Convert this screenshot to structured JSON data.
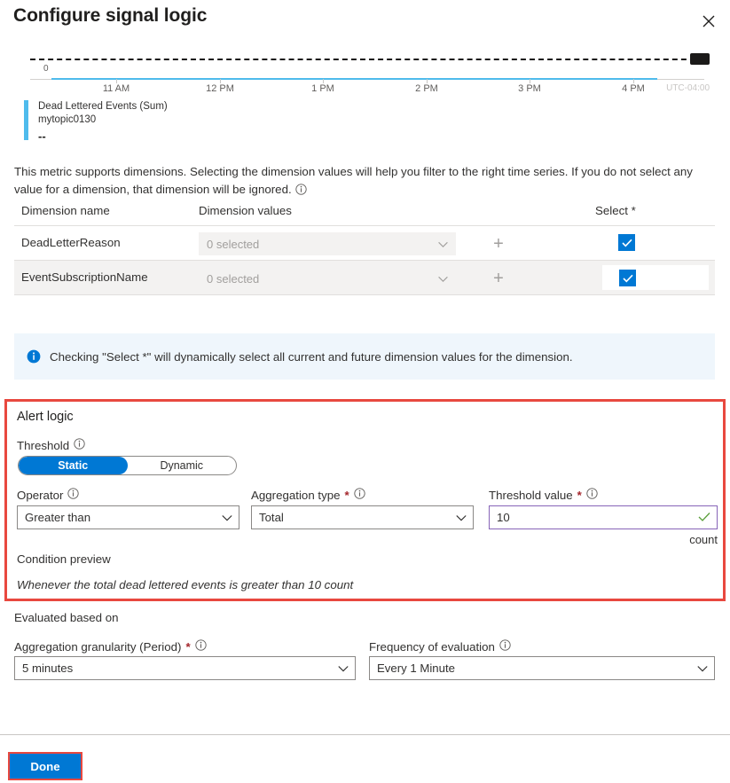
{
  "header": {
    "title": "Configure signal logic",
    "close_icon": "close-icon"
  },
  "chart": {
    "legend_metric": "Dead Lettered Events (Sum)",
    "legend_resource": "mytopic0130",
    "legend_value": "--",
    "y_zero_label": "0",
    "timezone": "UTC-04:00",
    "line_color": "#4fbbec",
    "threshold_color": "#1b1a19"
  },
  "chart_data": {
    "type": "line",
    "title": "",
    "subtitle": "",
    "xlabel": "",
    "ylabel": "",
    "grid": false,
    "legend_position": "below",
    "timezone": "UTC-04:00",
    "x_tick_labels": [
      "11 AM",
      "12 PM",
      "1 PM",
      "2 PM",
      "3 PM",
      "4 PM"
    ],
    "x_tick_positions_pct": [
      12.5,
      27.5,
      42.5,
      57.5,
      72.5,
      87.5
    ],
    "y_tick_labels": [
      "0"
    ],
    "ylim": [
      0,
      10
    ],
    "series": [
      {
        "name": "Dead Lettered Events (Sum)",
        "resource": "mytopic0130",
        "color": "#4fbbec",
        "value_display": "--",
        "x": [
          "11 AM",
          "12 PM",
          "1 PM",
          "2 PM",
          "3 PM",
          "4 PM"
        ],
        "values": [
          0,
          0,
          0,
          0,
          0,
          0
        ]
      }
    ],
    "annotations": [
      {
        "type": "threshold-line",
        "style": "dashed",
        "color": "#1b1a19",
        "value": 10,
        "label": ""
      }
    ]
  },
  "description": {
    "text": "This metric supports dimensions. Selecting the dimension values will help you filter to the right time series. If you do not select any value for a dimension, that dimension will be ignored.",
    "info_icon": "info-icon"
  },
  "dimensions_table": {
    "columns": [
      "Dimension name",
      "Dimension values",
      "Select *"
    ],
    "rows": [
      {
        "name": "DeadLetterReason",
        "value": "0 selected",
        "add_icon": "plus-icon",
        "checked": true
      },
      {
        "name": "EventSubscriptionName",
        "value": "0 selected",
        "add_icon": "plus-icon",
        "checked": true
      }
    ]
  },
  "info_banner": {
    "icon": "info-filled-icon",
    "text": "Checking \"Select *\" will dynamically select all current and future dimension values for the dimension."
  },
  "alert_logic": {
    "section_title": "Alert logic",
    "threshold_label": "Threshold",
    "threshold_options": [
      "Static",
      "Dynamic"
    ],
    "threshold_selected": "Static",
    "threshold_static": "Static",
    "threshold_dynamic": "Dynamic",
    "operator_label": "Operator",
    "operator_value": "Greater than",
    "aggregation_label": "Aggregation type",
    "aggregation_value": "Total",
    "threshold_value_label": "Threshold value",
    "threshold_value": "10",
    "threshold_unit": "count",
    "required_marker": "*",
    "condition_preview_label": "Condition preview",
    "condition_preview_text": "Whenever the total dead lettered events is greater than 10 count",
    "highlight_color": "#e8483f"
  },
  "evaluated": {
    "section_title": "Evaluated based on",
    "granularity_label": "Aggregation granularity (Period)",
    "granularity_value": "5 minutes",
    "frequency_label": "Frequency of evaluation",
    "frequency_value": "Every 1 Minute",
    "required_marker": "*"
  },
  "footer": {
    "done_label": "Done"
  }
}
